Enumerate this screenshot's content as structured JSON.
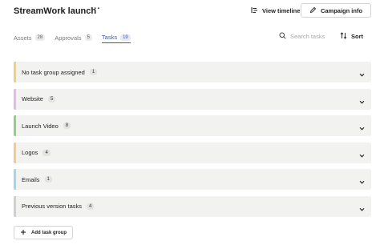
{
  "header": {
    "title": "StreamWork launch",
    "more_label": "···",
    "view_timeline_label": "View timeline",
    "campaign_info_label": "Campaign info"
  },
  "tabs": [
    {
      "label": "Assets",
      "count": "28",
      "active": false
    },
    {
      "label": "Approvals",
      "count": "5",
      "active": false
    },
    {
      "label": "Tasks",
      "count": "19",
      "active": true
    }
  ],
  "search": {
    "placeholder": "Search tasks"
  },
  "sort": {
    "label": "Sort"
  },
  "groups": [
    {
      "name": "No task group assigned",
      "count": "1",
      "color": "#f2cf7a"
    },
    {
      "name": "Website",
      "count": "5",
      "color": "#e4b8e8"
    },
    {
      "name": "Launch Video",
      "count": "8",
      "color": "#8fcf86"
    },
    {
      "name": "Logos",
      "count": "4",
      "color": "#f6c98b"
    },
    {
      "name": "Emails",
      "count": "1",
      "color": "#9ed8ee"
    },
    {
      "name": "Previous version tasks",
      "count": "4",
      "color": "#cfcfcf"
    }
  ],
  "add_group": {
    "label": "Add task group"
  },
  "icons": {
    "timeline": "timeline-icon",
    "campaign_info": "pencil-icon",
    "search": "search-icon",
    "sort": "sort-icon",
    "chevron": "chevron-down-icon",
    "add": "plus-icon"
  },
  "colors": {
    "accent": "#2a5bd7"
  }
}
